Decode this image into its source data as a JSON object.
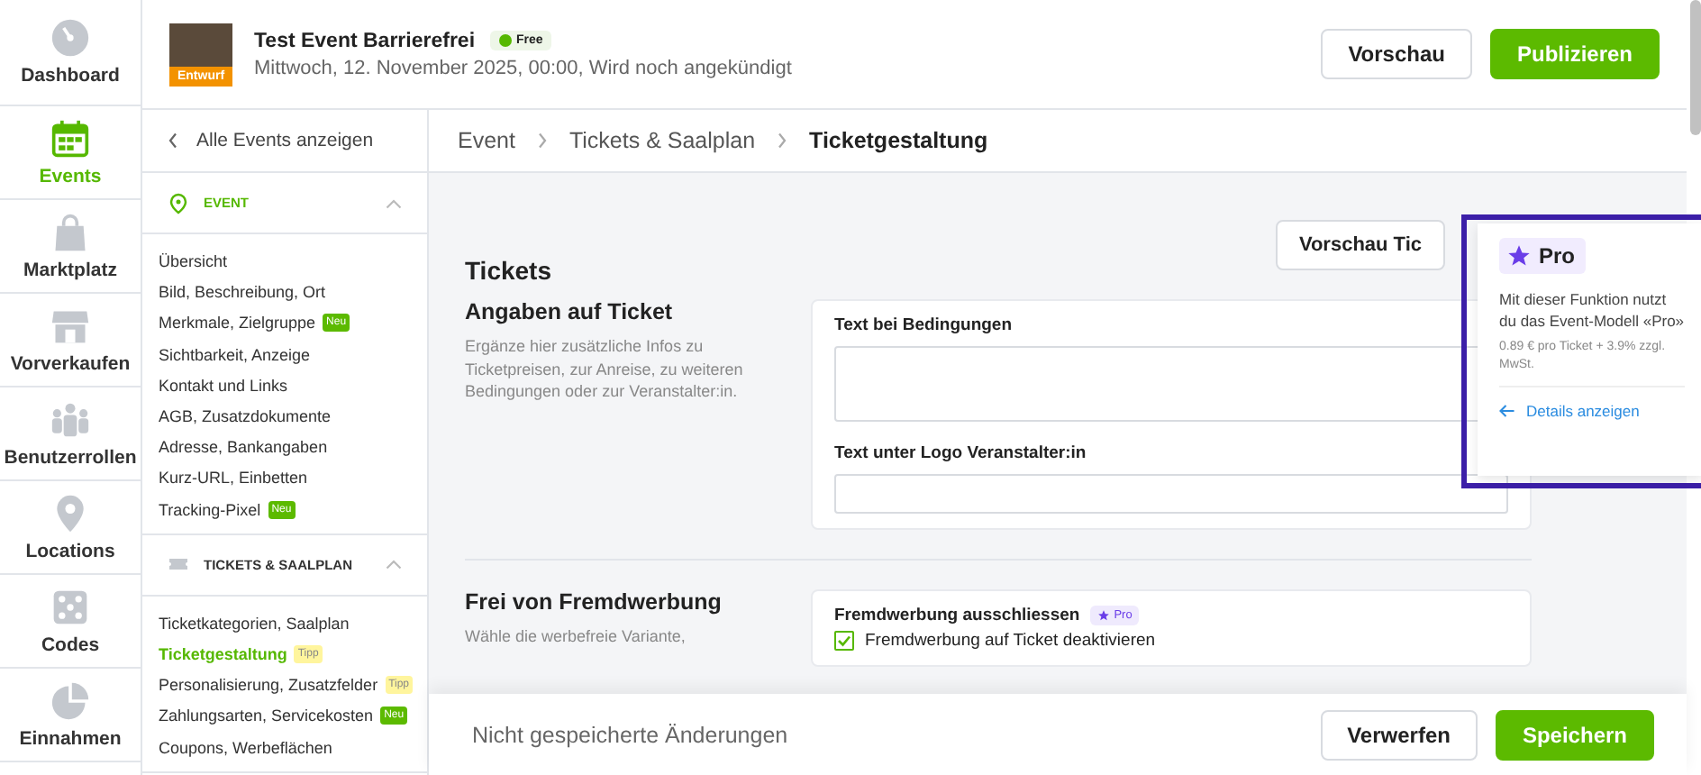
{
  "nav": [
    {
      "label": "Dashboard",
      "selected": false
    },
    {
      "label": "Events",
      "selected": true
    },
    {
      "label": "Marktplatz",
      "selected": false
    },
    {
      "label": "Vorverkaufen",
      "selected": false
    },
    {
      "label": "Benutzerrollen",
      "selected": false
    },
    {
      "label": "Locations",
      "selected": false
    },
    {
      "label": "Codes",
      "selected": false
    },
    {
      "label": "Einnahmen",
      "selected": false
    }
  ],
  "event": {
    "status": "Entwurf",
    "title": "Test Event Barrierefrei",
    "plan": "Free",
    "date": "Mittwoch, 12. November 2025, 00:00, Wird noch angekündigt"
  },
  "header_buttons": [
    {
      "label": "Vorschau",
      "kind": "secondary"
    },
    {
      "label": "Publizieren",
      "kind": "primary"
    }
  ],
  "sidebar": {
    "back": "Alle Events anzeigen",
    "sections": [
      {
        "title": "EVENT",
        "expanded": true,
        "items": [
          {
            "label": "Übersicht",
            "selected": false
          },
          {
            "label": "Bild, Beschreibung, Ort",
            "selected": false
          },
          {
            "label": "Merkmale, Zielgruppe",
            "selected": false,
            "badge": {
              "label": "Neu",
              "kind": "new"
            }
          },
          {
            "label": "Sichtbarkeit, Anzeige",
            "selected": false
          },
          {
            "label": "Kontakt und Links",
            "selected": false
          },
          {
            "label": "AGB, Zusatzdokumente",
            "selected": false
          },
          {
            "label": "Adresse, Bankangaben",
            "selected": false
          },
          {
            "label": "Kurz-URL, Einbetten",
            "selected": false
          },
          {
            "label": "Tracking-Pixel",
            "selected": false,
            "badge": {
              "label": "Neu",
              "kind": "new"
            }
          }
        ]
      },
      {
        "title": "TICKETS & SAALPLAN",
        "expanded": true,
        "items": [
          {
            "label": "Ticketkategorien, Saalplan",
            "selected": false
          },
          {
            "label": "Ticketgestaltung",
            "selected": true,
            "badge": {
              "label": "Tipp",
              "kind": "tip"
            }
          },
          {
            "label": "Personalisierung, Zusatzfelder",
            "selected": false,
            "badge": {
              "label": "Tipp",
              "kind": "tip"
            }
          },
          {
            "label": "Zahlungsarten, Servicekosten",
            "selected": false,
            "badge": {
              "label": "Neu",
              "kind": "new"
            }
          },
          {
            "label": "Coupons, Werbeflächen",
            "selected": false
          }
        ]
      }
    ]
  },
  "breadcrumb": [
    "Event",
    "Tickets & Saalplan",
    "Ticketgestaltung"
  ],
  "preview_button": "Vorschau Tic",
  "page_title": "Tickets",
  "sections": [
    {
      "title": "Angaben auf Ticket",
      "description": "Ergänze hier zusätzliche Infos zu Ticketpreisen, zur Anreise, zu weiteren Bedingungen oder zur Veranstalter:in.",
      "fields": [
        {
          "kind": "textarea",
          "label": "Text bei Bedingungen"
        },
        {
          "kind": "input",
          "label": "Text unter Logo Veranstalter:in"
        }
      ]
    },
    {
      "title": "Frei von Fremdwerbung",
      "description": "Wähle die werbefreie Variante,",
      "fields": [
        {
          "kind": "checkbox",
          "label": "Fremdwerbung ausschliessen",
          "badge": "Pro",
          "option": "Fremdwerbung auf Ticket deaktivieren",
          "checked": true
        }
      ]
    }
  ],
  "popover": {
    "badge": "Pro",
    "text": "Mit dieser Funktion nutzt du das Event-Modell «Pro»",
    "price": "0.89 € pro Ticket + 3.9% zzgl. MwSt.",
    "link": "Details anzeigen"
  },
  "footer": {
    "message": "Nicht gespeicherte Änderungen",
    "buttons": [
      {
        "label": "Verwerfen",
        "kind": "secondary"
      },
      {
        "label": "Speichern",
        "kind": "primary"
      }
    ]
  }
}
